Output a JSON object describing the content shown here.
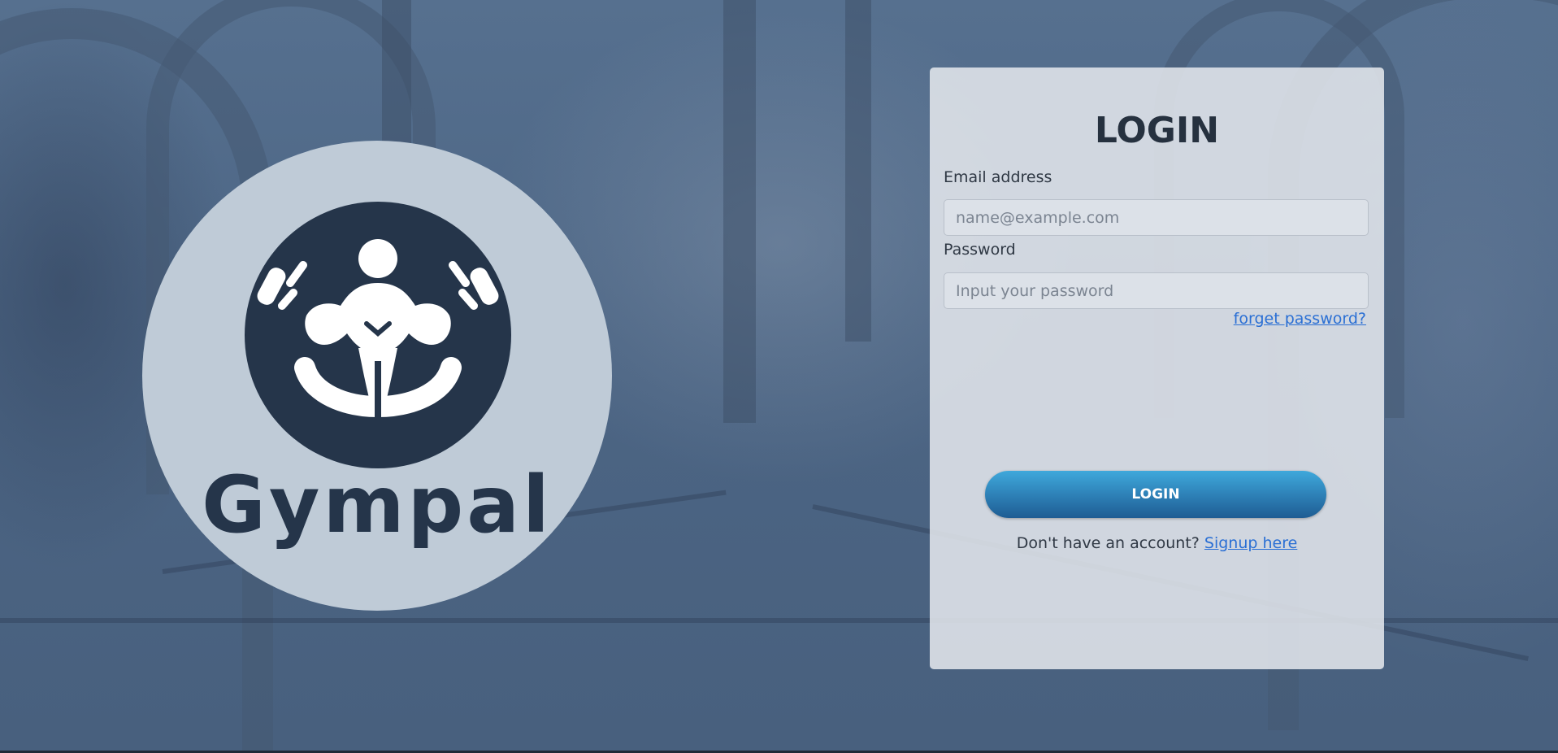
{
  "brand": {
    "name": "Gympal",
    "logo_icon": "muscle-person-emblem-icon"
  },
  "login_form": {
    "title": "LOGIN",
    "email": {
      "label": "Email address",
      "value": "",
      "placeholder": "name@example.com"
    },
    "password": {
      "label": "Password",
      "value": "",
      "placeholder": "Input your password"
    },
    "forgot_password_link": "forget password?",
    "submit_label": "LOGIN",
    "signup_prompt": "Don't have an account?",
    "signup_link": "Signup here"
  },
  "colors": {
    "accent": "#2e82b8",
    "link": "#2a6fd4",
    "brand_dark": "#25354a",
    "logo_circle": "#bfcbd7"
  }
}
